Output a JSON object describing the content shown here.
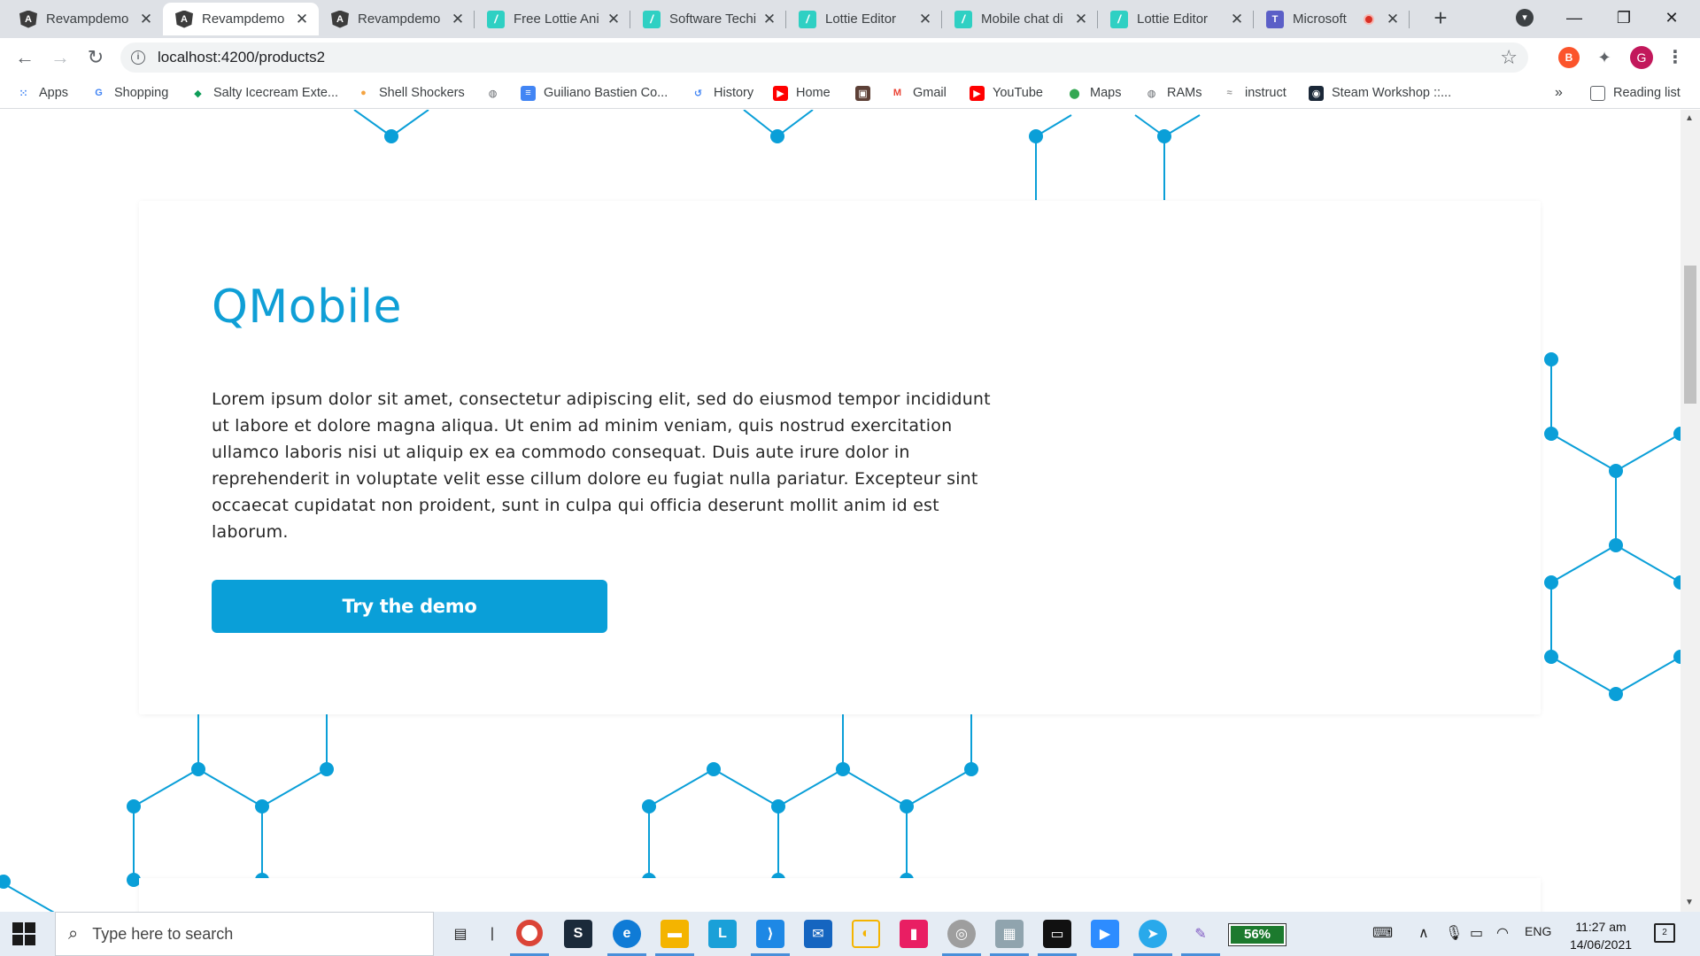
{
  "browser": {
    "tabs": [
      {
        "title": "Revampdemo",
        "icon": "angular-icon",
        "active": false
      },
      {
        "title": "Revampdemo",
        "icon": "angular-icon",
        "active": true
      },
      {
        "title": "Revampdemo",
        "icon": "angular-icon",
        "active": false
      },
      {
        "title": "Free Lottie Ani",
        "icon": "lottie-icon",
        "active": false
      },
      {
        "title": "Software Techi",
        "icon": "lottie-icon",
        "active": false
      },
      {
        "title": "Lottie Editor",
        "icon": "lottie-icon",
        "active": false
      },
      {
        "title": "Mobile chat di",
        "icon": "lottie-icon",
        "active": false
      },
      {
        "title": "Lottie Editor",
        "icon": "lottie-icon",
        "active": false
      },
      {
        "title": "Microsoft",
        "icon": "teams-icon",
        "active": false
      }
    ],
    "url": "localhost:4200/products2",
    "profile_initial": "G",
    "bookmarks": [
      {
        "label": "Apps",
        "icon": "apps-grid-icon"
      },
      {
        "label": "Shopping",
        "icon": "google-icon"
      },
      {
        "label": "Salty Icecream Exte...",
        "icon": "extension-icon"
      },
      {
        "label": "Shell Shockers",
        "icon": "egg-icon"
      },
      {
        "label": "",
        "icon": "globe-icon"
      },
      {
        "label": "Guiliano Bastien Co...",
        "icon": "docs-icon"
      },
      {
        "label": "History",
        "icon": "history-icon"
      },
      {
        "label": "Home",
        "icon": "youtube-icon"
      },
      {
        "label": "",
        "icon": "image-icon"
      },
      {
        "label": "Gmail",
        "icon": "gmail-icon"
      },
      {
        "label": "YouTube",
        "icon": "youtube-icon"
      },
      {
        "label": "Maps",
        "icon": "maps-icon"
      },
      {
        "label": "RAMs",
        "icon": "globe-icon"
      },
      {
        "label": "instruct",
        "icon": "bird-icon"
      },
      {
        "label": "Steam Workshop ::...",
        "icon": "steam-icon"
      }
    ],
    "overflow_label": "»",
    "reading_list": "Reading list"
  },
  "page": {
    "product_title": "QMobile",
    "description": "Lorem ipsum dolor sit amet, consectetur adipiscing elit, sed do eiusmod tempor incididunt ut labore et dolore magna aliqua. Ut enim ad minim veniam, quis nostrud exercitation ullamco laboris nisi ut aliquip ex ea commodo consequat. Duis aute irure dolor in reprehenderit in voluptate velit esse cillum dolore eu fugiat nulla pariatur. Excepteur sint occaecat cupidatat non proident, sunt in culpa qui officia deserunt mollit anim id est laborum.",
    "cta_label": "Try the demo",
    "accent_color": "#0a9fd8"
  },
  "taskbar": {
    "search_placeholder": "Type here to search",
    "battery": "56%",
    "language": "ENG",
    "time": "11:27 am",
    "date": "14/06/2021",
    "notification_count": "2"
  }
}
